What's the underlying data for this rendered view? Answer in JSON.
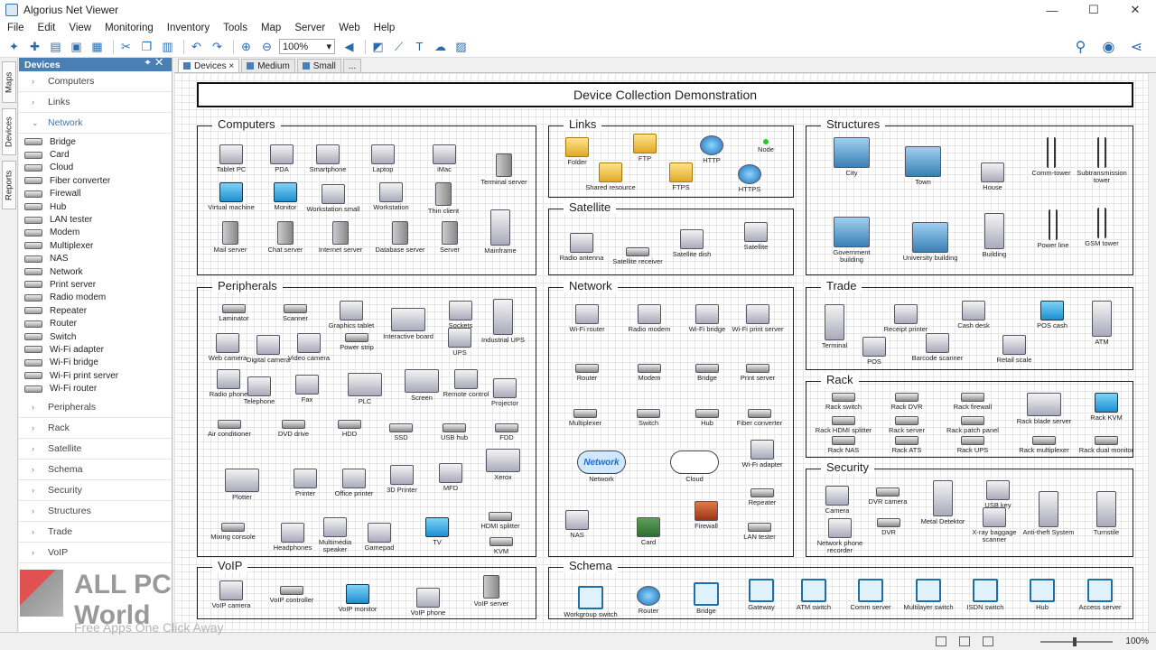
{
  "window": {
    "title": "Algorius Net Viewer",
    "controls": [
      "—",
      "☐",
      "✕"
    ]
  },
  "menu": [
    "File",
    "Edit",
    "View",
    "Monitoring",
    "Inventory",
    "Tools",
    "Map",
    "Server",
    "Web",
    "Help"
  ],
  "toolbar": {
    "zoom": "100%"
  },
  "sidetabs": [
    "Maps",
    "Devices",
    "Reports"
  ],
  "panel": {
    "title": "Devices",
    "categories_top": [
      "Computers",
      "Links"
    ],
    "open_category": "Network",
    "network_items": [
      "Bridge",
      "Card",
      "Cloud",
      "Fiber converter",
      "Firewall",
      "Hub",
      "LAN tester",
      "Modem",
      "Multiplexer",
      "NAS",
      "Network",
      "Print server",
      "Radio modem",
      "Repeater",
      "Router",
      "Switch",
      "Wi-Fi adapter",
      "Wi-Fi bridge",
      "Wi-Fi print server",
      "Wi-Fi router"
    ],
    "categories_bottom": [
      "Peripherals",
      "Rack",
      "Satellite",
      "Schema",
      "Security",
      "Structures",
      "Trade",
      "VoIP"
    ]
  },
  "tabs": [
    "Devices",
    "Medium",
    "Small",
    "..."
  ],
  "canvas": {
    "heading": "Device Collection Demonstration",
    "groups": {
      "computers": {
        "title": "Computers",
        "items": [
          "Tablet PC",
          "PDA",
          "Smartphone",
          "Laptop",
          "iMac",
          "Terminal server",
          "Virtual machine",
          "Monitor",
          "Workstation small",
          "Workstation",
          "Thin client",
          "Mail server",
          "Chat server",
          "Internet server",
          "Database server",
          "Server",
          "Mainframe"
        ]
      },
      "links": {
        "title": "Links",
        "items": [
          "Folder",
          "FTP",
          "HTTP",
          "Node",
          "Shared resource",
          "FTPS",
          "HTTPS"
        ]
      },
      "structures": {
        "title": "Structures",
        "items": [
          "City",
          "Town",
          "House",
          "Comm-tower",
          "Subtransmission tower",
          "Government building",
          "University building",
          "Building",
          "Power line",
          "GSM tower"
        ]
      },
      "satellite": {
        "title": "Satellite",
        "items": [
          "Radio antenna",
          "Satellite receiver",
          "Satellite dish",
          "Satellite"
        ]
      },
      "peripherals": {
        "title": "Peripherals",
        "items": [
          "Laminator",
          "Scanner",
          "Graphics tablet",
          "Interactive board",
          "Sockets",
          "Industrial UPS",
          "Web camera",
          "Digital camera",
          "Video camera",
          "Power strip",
          "UPS",
          "Radio phone",
          "Telephone",
          "Fax",
          "PLC",
          "Screen",
          "Remote control",
          "Projector",
          "Air conditioner",
          "DVD drive",
          "HDD",
          "SSD",
          "USB hub",
          "FDD",
          "Plotter",
          "Printer",
          "Office printer",
          "3D Printer",
          "MFD",
          "Xerox",
          "HDMI splitter",
          "Mixing console",
          "Headphones",
          "Multimedia speaker",
          "Gamepad",
          "TV",
          "KVM"
        ]
      },
      "network": {
        "title": "Network",
        "items": [
          "Wi-Fi router",
          "Radio modem",
          "Wi-Fi bridge",
          "Wi-Fi print server",
          "Router",
          "Modem",
          "Bridge",
          "Print server",
          "Multiplexer",
          "Switch",
          "Hub",
          "Fiber converter",
          "Network",
          "Cloud",
          "Wi-Fi adapter",
          "Repeater",
          "NAS",
          "Card",
          "Firewall",
          "LAN tester"
        ],
        "cloud_label": "Network"
      },
      "trade": {
        "title": "Trade",
        "items": [
          "Terminal",
          "Receipt printer",
          "Cash desk",
          "POS cash",
          "POS",
          "Barcode scanner",
          "Retail scale",
          "ATM"
        ]
      },
      "rack": {
        "title": "Rack",
        "items": [
          "Rack switch",
          "Rack DVR",
          "Rack firewall",
          "Rack blade server",
          "Rack KVM",
          "Rack HDMI splitter",
          "Rack server",
          "Rack patch panel",
          "Rack NAS",
          "Rack ATS",
          "Rack UPS",
          "Rack multiplexer",
          "Rack dual monitor"
        ]
      },
      "security": {
        "title": "Security",
        "items": [
          "Camera",
          "DVR camera",
          "USB key",
          "Network phone recorder",
          "DVR",
          "Metal Detektor",
          "X-ray baggage scanner",
          "Anti-theft System",
          "Turnstile"
        ]
      },
      "voip": {
        "title": "VoIP",
        "items": [
          "VoIP camera",
          "VoIP controller",
          "VoIP monitor",
          "VoIP phone",
          "VoIP server"
        ]
      },
      "schema": {
        "title": "Schema",
        "items": [
          "Workgroup switch",
          "Router",
          "Bridge",
          "Gateway",
          "ATM switch",
          "Comm server",
          "Multilayer switch",
          "ISDN switch",
          "Hub",
          "Access server"
        ]
      }
    }
  },
  "status": {
    "zoom": "100%"
  },
  "watermark": {
    "title": "ALL PC World",
    "subtitle": "Free Apps One Click Away"
  }
}
